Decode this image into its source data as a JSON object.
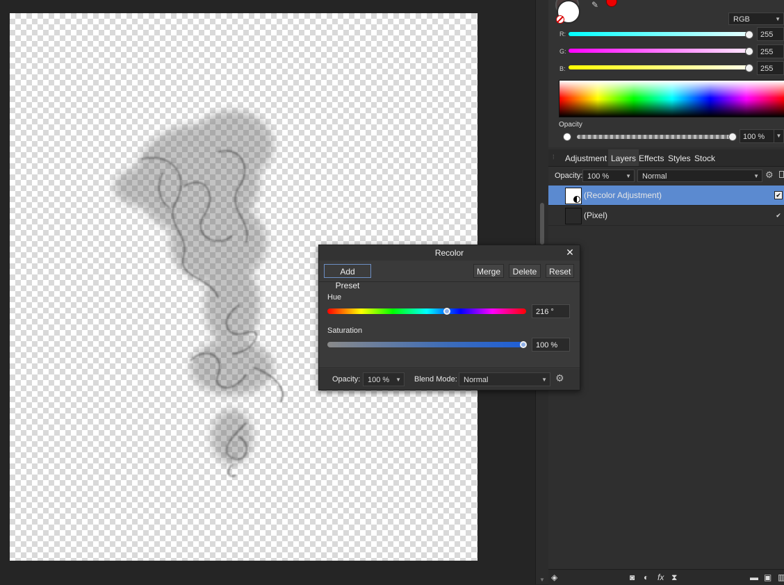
{
  "color_panel": {
    "model": "RGB",
    "channels": [
      {
        "label": "R:",
        "value": "255",
        "color": "#00ffff"
      },
      {
        "label": "G:",
        "value": "255",
        "color": "#ff00ff"
      },
      {
        "label": "B:",
        "value": "255",
        "color": "#ffff00"
      }
    ],
    "opacity_label": "Opacity",
    "opacity_value": "100 %"
  },
  "tabs": [
    "Adjustment",
    "Layers",
    "Effects",
    "Styles",
    "Stock"
  ],
  "active_tab": "Layers",
  "layers_panel": {
    "opacity_label": "Opacity:",
    "opacity_value": "100 %",
    "blend_mode": "Normal",
    "layers": [
      {
        "name": "(Recolor Adjustment)",
        "selected": true
      },
      {
        "name": "(Pixel)",
        "selected": false
      }
    ]
  },
  "recolor_dialog": {
    "title": "Recolor",
    "add_preset": "Add Preset",
    "merge": "Merge",
    "delete": "Delete",
    "reset": "Reset",
    "hue_label": "Hue",
    "hue_value": "216 °",
    "hue_level": 0.6,
    "saturation_label": "Saturation",
    "saturation_value": "100 %",
    "saturation_level": 1.0,
    "opacity_label": "Opacity:",
    "opacity_value": "100 %",
    "blend_label": "Blend Mode:",
    "blend_value": "Normal"
  },
  "icons": [
    "eyedropper-icon",
    "no-fill-icon",
    "gear-icon",
    "lock-icon",
    "layers-icon",
    "mask-icon",
    "adjustment-icon",
    "fx-icon",
    "live-filter-icon",
    "folder-icon",
    "new-layer-icon",
    "delete-icon",
    "close-icon"
  ],
  "colors": {
    "selected_row": "#5b8ad0",
    "accent": "#6d8fc4"
  }
}
